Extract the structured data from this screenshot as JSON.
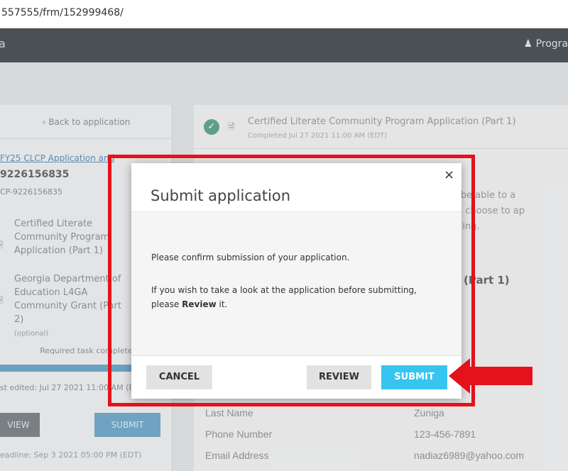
{
  "browser": {
    "url": "557555/frm/152999468/"
  },
  "header": {
    "brand": "a",
    "program_label": "Progra",
    "program_icon": "person-icon"
  },
  "left_panel": {
    "back_label": "Back to application",
    "app_link": "FY25 CLCP Application and",
    "app_number": "9226156835",
    "app_code": "CP-9226156835",
    "tasks": [
      {
        "label": "Certified Literate Community Program Application (Part 1)"
      },
      {
        "label": "Georgia Department of Education L4GA Community Grant (Part 2)",
        "note": "(optional)"
      }
    ],
    "required_label": "Required task complete",
    "progress": 1.0,
    "last_edited": "st edited: Jul 27 2021 11:00 AM (E",
    "view_label": "VIEW",
    "submit_label": "SUBMIT",
    "deadline": "eadline: Sep 3 2021 05:00 PM (EDT)"
  },
  "right_panel": {
    "task_title": "Certified Literate Community Program Application (Part 1)",
    "task_status": "Completed Jul 27 2021 11:00 AM (EDT)",
    "fragments": [
      "e you will be able to a",
      "rt 2) if you choose to ap",
      "grant funding."
    ],
    "section_title": "(Part 1)",
    "fields": [
      {
        "label": "Last Name",
        "value": "Zuniga"
      },
      {
        "label": "Phone Number",
        "value": "123-456-7891"
      },
      {
        "label": "Email Address",
        "value": "nadiaz6989@yahoo.com"
      }
    ]
  },
  "modal": {
    "title": "Submit application",
    "close_glyph": "×",
    "message": "Please confirm submission of your application.",
    "review_prefix": "If you wish to take a look at the application before submitting, please ",
    "review_bold": "Review",
    "review_suffix": " it.",
    "cancel_label": "CANCEL",
    "review_label": "REVIEW",
    "submit_label": "SUBMIT"
  },
  "colors": {
    "annotation": "#e3121b",
    "submit": "#35c5f0",
    "header": "#4b5055"
  }
}
